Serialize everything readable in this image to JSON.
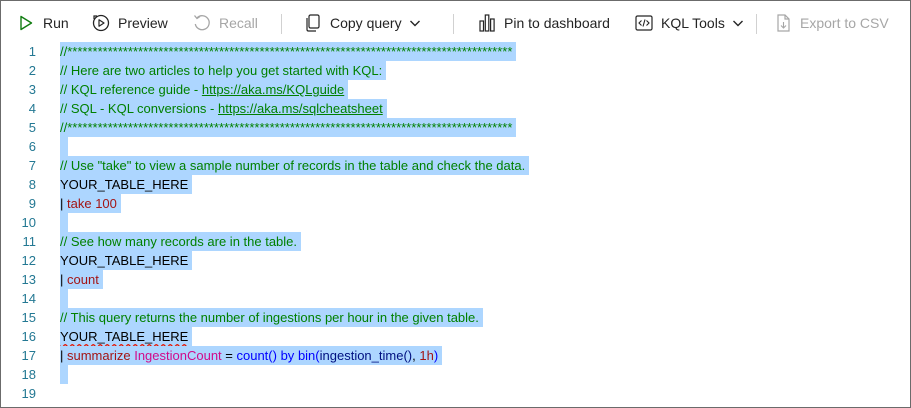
{
  "toolbar": {
    "run_label": "Run",
    "preview_label": "Preview",
    "recall_label": "Recall",
    "copy_query_label": "Copy query",
    "pin_label": "Pin to dashboard",
    "kql_tools_label": "KQL Tools",
    "export_label": "Export to CSV"
  },
  "colors": {
    "selection": "#add6ff",
    "line_number": "#237893",
    "comment": "#008000",
    "keyword": "#a31515",
    "function": "#0000ff",
    "identifier": "#001080",
    "field": "#d10b8a",
    "run_icon": "#107c10"
  },
  "icons": [
    "play-icon",
    "preview-icon",
    "recall-icon",
    "copy-icon",
    "chevron-down-icon",
    "dashboard-pin-icon",
    "kql-tools-icon",
    "export-csv-icon"
  ],
  "editor": {
    "line_numbers": [
      "1",
      "2",
      "3",
      "4",
      "5",
      "6",
      "7",
      "8",
      "9",
      "10",
      "11",
      "12",
      "13",
      "14",
      "15",
      "16",
      "17",
      "18",
      "19"
    ],
    "stars_line": "//****************************************************************************************",
    "l2": "// Here are two articles to help you get started with KQL:",
    "l3_prefix": "// KQL reference guide - ",
    "l3_link": "https://aka.ms/KQLguide",
    "l4_prefix": "// SQL - KQL conversions - ",
    "l4_link": "https://aka.ms/sqlcheatsheet",
    "l7": "// Use \"take\" to view a sample number of records in the table and check the data.",
    "table_name": "YOUR_TABLE_HERE",
    "pipe": "| ",
    "take_kw": "take",
    "take_num": "100",
    "l11": "// See how many records are in the table.",
    "count_kw": "count",
    "l15": "// This query returns the number of ingestions per hour in the given table.",
    "summarize_kw": "summarize",
    "ingestion_count": "IngestionCount",
    "eq": " = ",
    "count_fn": "count()",
    "by_kw": "by",
    "bin_fn": "bin(",
    "ingestion_time_fn": "ingestion_time()",
    "bin_comma": ", ",
    "bin_arg": "1h",
    "bin_close": ")"
  }
}
